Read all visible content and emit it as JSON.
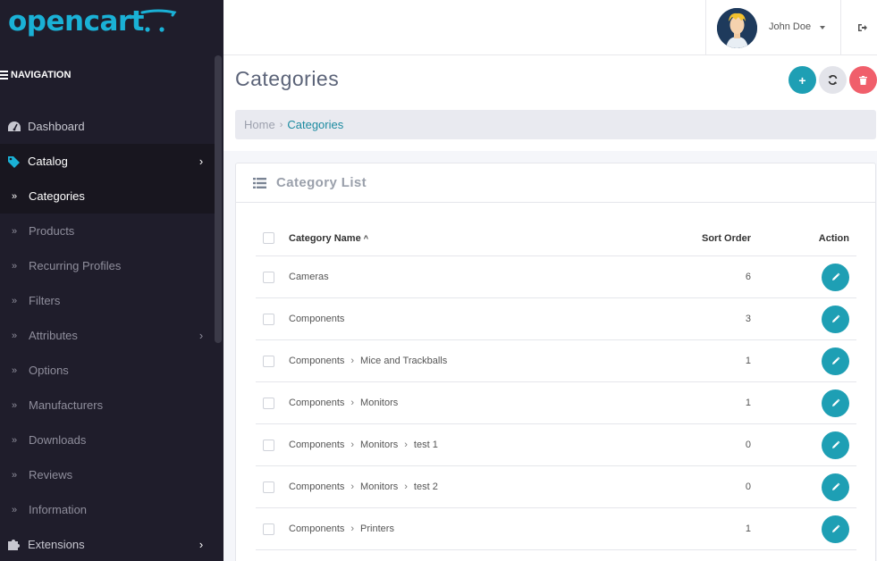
{
  "brand": {
    "name": "opencart",
    "color": "#1ab1d6"
  },
  "sidebar": {
    "nav_heading": "NAVIGATION",
    "items": [
      {
        "label": "Dashboard",
        "icon": "dashboard-icon"
      },
      {
        "label": "Catalog",
        "icon": "tag-icon",
        "expanded": true
      },
      {
        "label": "Categories",
        "current": true
      },
      {
        "label": "Products"
      },
      {
        "label": "Recurring Profiles"
      },
      {
        "label": "Filters"
      },
      {
        "label": "Attributes",
        "has_children": true
      },
      {
        "label": "Options"
      },
      {
        "label": "Manufacturers"
      },
      {
        "label": "Downloads"
      },
      {
        "label": "Reviews"
      },
      {
        "label": "Information"
      },
      {
        "label": "Extensions",
        "icon": "puzzle-icon",
        "has_children": true
      }
    ]
  },
  "header": {
    "user_name": "John Doe"
  },
  "page": {
    "title": "Categories",
    "breadcrumb": {
      "home": "Home",
      "current": "Categories"
    }
  },
  "panel": {
    "title": "Category List",
    "columns": {
      "name": "Category Name",
      "sort_order": "Sort Order",
      "action": "Action"
    },
    "rows": [
      {
        "path": [
          "Cameras"
        ],
        "sort_order": "6"
      },
      {
        "path": [
          "Components"
        ],
        "sort_order": "3"
      },
      {
        "path": [
          "Components",
          "Mice and Trackballs"
        ],
        "sort_order": "1"
      },
      {
        "path": [
          "Components",
          "Monitors"
        ],
        "sort_order": "1"
      },
      {
        "path": [
          "Components",
          "Monitors",
          "test 1"
        ],
        "sort_order": "0"
      },
      {
        "path": [
          "Components",
          "Monitors",
          "test 2"
        ],
        "sort_order": "0"
      },
      {
        "path": [
          "Components",
          "Printers"
        ],
        "sort_order": "1"
      }
    ]
  },
  "colors": {
    "accent": "#1e9fb4",
    "danger": "#f05f6b",
    "sidebar_bg": "#1f1d2b"
  }
}
